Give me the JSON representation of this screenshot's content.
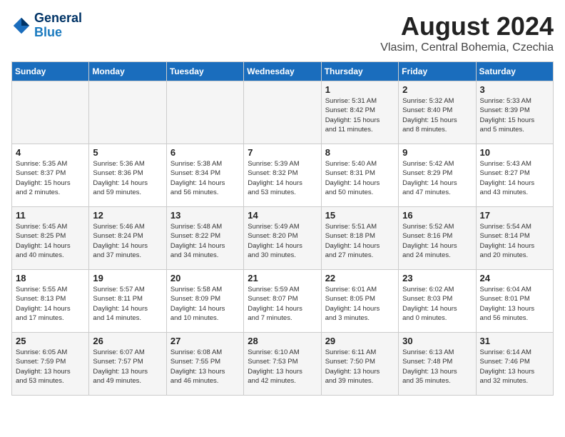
{
  "logo": {
    "name1": "General",
    "name2": "Blue"
  },
  "title": {
    "month_year": "August 2024",
    "location": "Vlasim, Central Bohemia, Czechia"
  },
  "headers": [
    "Sunday",
    "Monday",
    "Tuesday",
    "Wednesday",
    "Thursday",
    "Friday",
    "Saturday"
  ],
  "weeks": [
    [
      {
        "day": "",
        "info": ""
      },
      {
        "day": "",
        "info": ""
      },
      {
        "day": "",
        "info": ""
      },
      {
        "day": "",
        "info": ""
      },
      {
        "day": "1",
        "info": "Sunrise: 5:31 AM\nSunset: 8:42 PM\nDaylight: 15 hours\nand 11 minutes."
      },
      {
        "day": "2",
        "info": "Sunrise: 5:32 AM\nSunset: 8:40 PM\nDaylight: 15 hours\nand 8 minutes."
      },
      {
        "day": "3",
        "info": "Sunrise: 5:33 AM\nSunset: 8:39 PM\nDaylight: 15 hours\nand 5 minutes."
      }
    ],
    [
      {
        "day": "4",
        "info": "Sunrise: 5:35 AM\nSunset: 8:37 PM\nDaylight: 15 hours\nand 2 minutes."
      },
      {
        "day": "5",
        "info": "Sunrise: 5:36 AM\nSunset: 8:36 PM\nDaylight: 14 hours\nand 59 minutes."
      },
      {
        "day": "6",
        "info": "Sunrise: 5:38 AM\nSunset: 8:34 PM\nDaylight: 14 hours\nand 56 minutes."
      },
      {
        "day": "7",
        "info": "Sunrise: 5:39 AM\nSunset: 8:32 PM\nDaylight: 14 hours\nand 53 minutes."
      },
      {
        "day": "8",
        "info": "Sunrise: 5:40 AM\nSunset: 8:31 PM\nDaylight: 14 hours\nand 50 minutes."
      },
      {
        "day": "9",
        "info": "Sunrise: 5:42 AM\nSunset: 8:29 PM\nDaylight: 14 hours\nand 47 minutes."
      },
      {
        "day": "10",
        "info": "Sunrise: 5:43 AM\nSunset: 8:27 PM\nDaylight: 14 hours\nand 43 minutes."
      }
    ],
    [
      {
        "day": "11",
        "info": "Sunrise: 5:45 AM\nSunset: 8:25 PM\nDaylight: 14 hours\nand 40 minutes."
      },
      {
        "day": "12",
        "info": "Sunrise: 5:46 AM\nSunset: 8:24 PM\nDaylight: 14 hours\nand 37 minutes."
      },
      {
        "day": "13",
        "info": "Sunrise: 5:48 AM\nSunset: 8:22 PM\nDaylight: 14 hours\nand 34 minutes."
      },
      {
        "day": "14",
        "info": "Sunrise: 5:49 AM\nSunset: 8:20 PM\nDaylight: 14 hours\nand 30 minutes."
      },
      {
        "day": "15",
        "info": "Sunrise: 5:51 AM\nSunset: 8:18 PM\nDaylight: 14 hours\nand 27 minutes."
      },
      {
        "day": "16",
        "info": "Sunrise: 5:52 AM\nSunset: 8:16 PM\nDaylight: 14 hours\nand 24 minutes."
      },
      {
        "day": "17",
        "info": "Sunrise: 5:54 AM\nSunset: 8:14 PM\nDaylight: 14 hours\nand 20 minutes."
      }
    ],
    [
      {
        "day": "18",
        "info": "Sunrise: 5:55 AM\nSunset: 8:13 PM\nDaylight: 14 hours\nand 17 minutes."
      },
      {
        "day": "19",
        "info": "Sunrise: 5:57 AM\nSunset: 8:11 PM\nDaylight: 14 hours\nand 14 minutes."
      },
      {
        "day": "20",
        "info": "Sunrise: 5:58 AM\nSunset: 8:09 PM\nDaylight: 14 hours\nand 10 minutes."
      },
      {
        "day": "21",
        "info": "Sunrise: 5:59 AM\nSunset: 8:07 PM\nDaylight: 14 hours\nand 7 minutes."
      },
      {
        "day": "22",
        "info": "Sunrise: 6:01 AM\nSunset: 8:05 PM\nDaylight: 14 hours\nand 3 minutes."
      },
      {
        "day": "23",
        "info": "Sunrise: 6:02 AM\nSunset: 8:03 PM\nDaylight: 14 hours\nand 0 minutes."
      },
      {
        "day": "24",
        "info": "Sunrise: 6:04 AM\nSunset: 8:01 PM\nDaylight: 13 hours\nand 56 minutes."
      }
    ],
    [
      {
        "day": "25",
        "info": "Sunrise: 6:05 AM\nSunset: 7:59 PM\nDaylight: 13 hours\nand 53 minutes."
      },
      {
        "day": "26",
        "info": "Sunrise: 6:07 AM\nSunset: 7:57 PM\nDaylight: 13 hours\nand 49 minutes."
      },
      {
        "day": "27",
        "info": "Sunrise: 6:08 AM\nSunset: 7:55 PM\nDaylight: 13 hours\nand 46 minutes."
      },
      {
        "day": "28",
        "info": "Sunrise: 6:10 AM\nSunset: 7:53 PM\nDaylight: 13 hours\nand 42 minutes."
      },
      {
        "day": "29",
        "info": "Sunrise: 6:11 AM\nSunset: 7:50 PM\nDaylight: 13 hours\nand 39 minutes."
      },
      {
        "day": "30",
        "info": "Sunrise: 6:13 AM\nSunset: 7:48 PM\nDaylight: 13 hours\nand 35 minutes."
      },
      {
        "day": "31",
        "info": "Sunrise: 6:14 AM\nSunset: 7:46 PM\nDaylight: 13 hours\nand 32 minutes."
      }
    ]
  ]
}
